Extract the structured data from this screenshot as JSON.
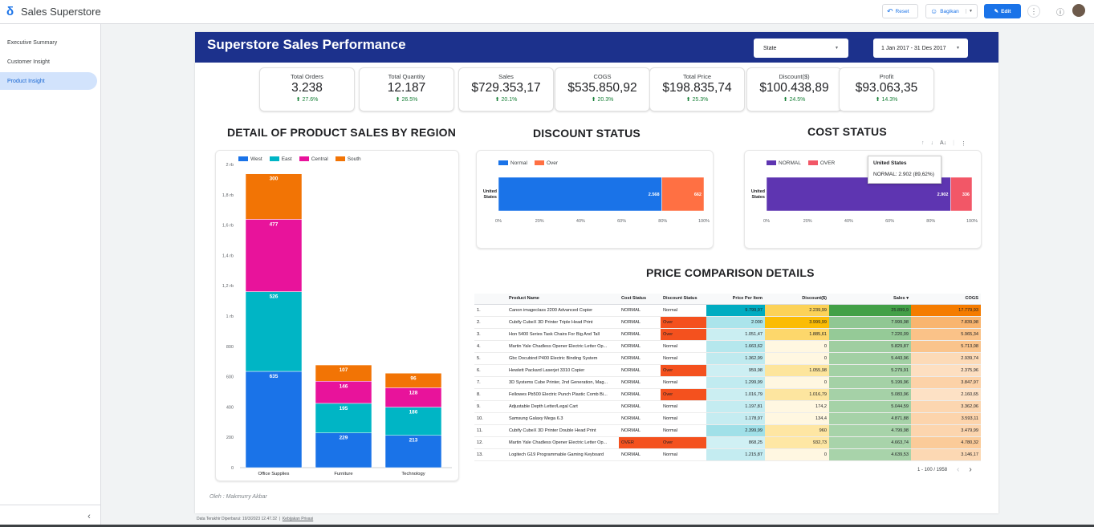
{
  "app": {
    "title": "Sales Superstore"
  },
  "toolbar": {
    "reset_label": "Reset",
    "share_label": "Bagikan",
    "edit_label": "Edit"
  },
  "sidebar": {
    "items": [
      {
        "label": "Executive Summary",
        "active": false
      },
      {
        "label": "Customer Insight",
        "active": false
      },
      {
        "label": "Product Insight",
        "active": true
      }
    ]
  },
  "report": {
    "title": "Superstore Sales Performance",
    "state_filter": "State",
    "date_range": "1 Jan 2017 - 31 Des 2017",
    "credit": "Oleh : Makmurry Akbar"
  },
  "kpis": [
    {
      "label": "Total Orders",
      "value": "3.238",
      "delta": "27.6%"
    },
    {
      "label": "Total Quantity",
      "value": "12.187",
      "delta": "26.5%"
    },
    {
      "label": "Sales",
      "value": "$729.353,17",
      "delta": "20.1%"
    },
    {
      "label": "COGS",
      "value": "$535.850,92",
      "delta": "20.3%"
    },
    {
      "label": "Total Price",
      "value": "$198.835,74",
      "delta": "25.3%"
    },
    {
      "label": "Discount($)",
      "value": "$100.438,89",
      "delta": "24.5%"
    },
    {
      "label": "Profit",
      "value": "$93.063,35",
      "delta": "14.3%"
    }
  ],
  "sections": {
    "region": "DETAIL OF PRODUCT SALES BY REGION",
    "discount": "DISCOUNT STATUS",
    "cost": "COST STATUS",
    "price": "PRICE COMPARISON DETAILS"
  },
  "colors": {
    "header": "#1c318c",
    "west": "#1a73e8",
    "east": "#00b5c5",
    "central": "#e8139b",
    "south": "#f27405",
    "normal_d": "#1a73e8",
    "over_d": "#ff7043",
    "normal_c": "#5e35b1",
    "over_c": "#f25767"
  },
  "tooltip": {
    "title": "United States",
    "body": "NORMAL: 2.902 (89,62%)"
  },
  "pager": {
    "label": "1 - 100 / 1958"
  },
  "footer": {
    "updated": "Data Terakhir Diperbarui: 19/3/2023 12.47.32",
    "privacy": "Kebijakan Privasi"
  },
  "chart_data": [
    {
      "type": "bar",
      "stacked": true,
      "title": "DETAIL OF PRODUCT SALES BY REGION",
      "categories": [
        "Office Supplies",
        "Furniture",
        "Technology"
      ],
      "series": [
        {
          "name": "West",
          "values": [
            635,
            229,
            213
          ]
        },
        {
          "name": "East",
          "values": [
            526,
            195,
            186
          ]
        },
        {
          "name": "Central",
          "values": [
            477,
            146,
            128
          ]
        },
        {
          "name": "South",
          "values": [
            300,
            107,
            96
          ]
        }
      ],
      "y_ticks": [
        "0",
        "200",
        "400",
        "600",
        "800",
        "1 rb",
        "1,2 rb",
        "1,4 rb",
        "1,6 rb",
        "1,8 rb",
        "2 rb"
      ],
      "ylim": [
        0,
        2000
      ],
      "legend": "top"
    },
    {
      "type": "bar",
      "orientation": "horizontal",
      "stacked_percent": true,
      "title": "DISCOUNT STATUS",
      "categories": [
        "United States"
      ],
      "series": [
        {
          "name": "Normal",
          "values": [
            2568
          ]
        },
        {
          "name": "Over",
          "values": [
            662
          ]
        }
      ],
      "x_ticks": [
        "0%",
        "20%",
        "40%",
        "60%",
        "80%",
        "100%"
      ],
      "legend": "top-left"
    },
    {
      "type": "bar",
      "orientation": "horizontal",
      "stacked_percent": true,
      "title": "COST STATUS",
      "categories": [
        "United States"
      ],
      "series": [
        {
          "name": "NORMAL",
          "values": [
            2902
          ]
        },
        {
          "name": "OVER",
          "values": [
            336
          ]
        }
      ],
      "x_ticks": [
        "0%",
        "20%",
        "40%",
        "60%",
        "80%",
        "100%"
      ],
      "legend": "top-left"
    },
    {
      "type": "table",
      "title": "PRICE COMPARISON DETAILS",
      "columns": [
        "",
        "Product Name",
        "Cost Status",
        "Discount Status",
        "Price Per Item",
        "Discount($)",
        "Sales ▾",
        "COGS"
      ],
      "rows": [
        [
          "1.",
          "Canon imageclass 2200 Advanced Copier",
          "NORMAL",
          "Normal",
          "9.799,97",
          "2.239,99",
          "25.899,9",
          "17.779,93"
        ],
        [
          "2.",
          "Cubify CubeX 3D Printer Triple Head Print",
          "NORMAL",
          "Over",
          "2.000",
          "3.999,99",
          "7.999,98",
          "7.839,98"
        ],
        [
          "3.",
          "Hon 5400 Series Task Chairs For Big And Tall",
          "NORMAL",
          "Over",
          "1.051,47",
          "1.885,61",
          "7.220,09",
          "5.965,34"
        ],
        [
          "4.",
          "Martin Yale Chadless Opener Electric Letter Op...",
          "NORMAL",
          "Normal",
          "1.663,62",
          "0",
          "5.829,87",
          "5.713,08"
        ],
        [
          "5.",
          "Gbc Docubind P400 Electric Binding System",
          "NORMAL",
          "Normal",
          "1.362,99",
          "0",
          "5.443,96",
          "2.939,74"
        ],
        [
          "6.",
          "Hewlett Packard Laserjet 3310 Copier",
          "NORMAL",
          "Over",
          "959,98",
          "1.055,98",
          "5.279,91",
          "2.375,96"
        ],
        [
          "7.",
          "3D Systems Cube Printer, 2nd Generation, Mag...",
          "NORMAL",
          "Normal",
          "1.299,99",
          "0",
          "5.199,96",
          "3.847,97"
        ],
        [
          "8.",
          "Fellowes Pb500 Electric Punch Plastic Comb Bi...",
          "NORMAL",
          "Over",
          "1.016,79",
          "1.016,79",
          "5.083,96",
          "2.160,65"
        ],
        [
          "9.",
          "Adjustable Depth Letter/Legal Cart",
          "NORMAL",
          "Normal",
          "1.197,81",
          "174,2",
          "5.044,59",
          "3.362,06"
        ],
        [
          "10.",
          "Samsung Galaxy Mega 6.3",
          "NORMAL",
          "Normal",
          "1.178,97",
          "134,4",
          "4.871,88",
          "3.593,11"
        ],
        [
          "11.",
          "Cubify CubeX 3D Printer Double Head Print",
          "NORMAL",
          "Normal",
          "2.399,99",
          "960",
          "4.799,98",
          "3.479,99"
        ],
        [
          "12.",
          "Martin Yale Chadless Opener Electric Letter Op...",
          "OVER",
          "Over",
          "868,25",
          "932,73",
          "4.663,74",
          "4.780,32"
        ],
        [
          "13.",
          "Logitech G19 Programmable Gaming Keyboard",
          "NORMAL",
          "Normal",
          "1.215,87",
          "0",
          "4.639,53",
          "3.146,17"
        ]
      ]
    }
  ]
}
